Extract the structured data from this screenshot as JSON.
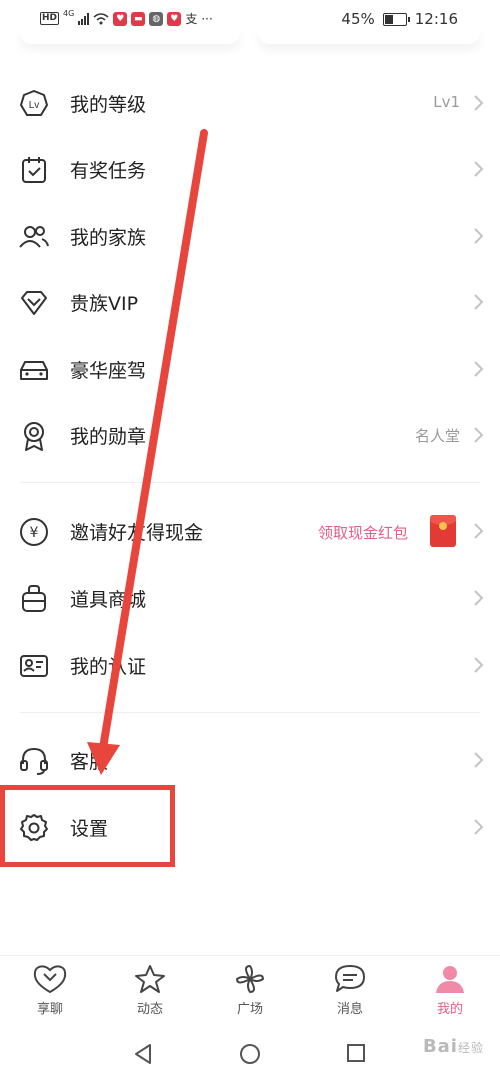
{
  "status_bar": {
    "left_badge": "HD",
    "network_badge": "4G",
    "extra_char": "支",
    "more": "···",
    "battery_percent": "45%",
    "battery_level": 0.45,
    "time": "12:16"
  },
  "menu": {
    "items": [
      {
        "label": "我的等级",
        "icon": "level-icon",
        "right": "Lv1"
      },
      {
        "label": "有奖任务",
        "icon": "task-calendar-icon",
        "right": ""
      },
      {
        "label": "我的家族",
        "icon": "family-people-icon",
        "right": ""
      },
      {
        "label": "贵族VIP",
        "icon": "diamond-icon",
        "right": ""
      },
      {
        "label": "豪华座驾",
        "icon": "car-icon",
        "right": ""
      },
      {
        "label": "我的勋章",
        "icon": "medal-icon",
        "right": "名人堂"
      },
      {
        "label": "邀请好友得现金",
        "icon": "yuan-coin-icon",
        "right": "领取现金红包"
      },
      {
        "label": "道具商城",
        "icon": "shop-bag-icon",
        "right": ""
      },
      {
        "label": "我的认证",
        "icon": "id-card-icon",
        "right": ""
      },
      {
        "label": "客服",
        "icon": "headset-icon",
        "right": ""
      },
      {
        "label": "设置",
        "icon": "gear-icon",
        "right": ""
      }
    ]
  },
  "tabbar": {
    "tabs": [
      {
        "label": "享聊",
        "icon": "chat-hearts-icon",
        "active": false
      },
      {
        "label": "动态",
        "icon": "star-icon",
        "active": false
      },
      {
        "label": "广场",
        "icon": "pinwheel-icon",
        "active": false
      },
      {
        "label": "消息",
        "icon": "message-bubble-icon",
        "active": false
      },
      {
        "label": "我的",
        "icon": "profile-icon",
        "active": true
      }
    ]
  },
  "watermark": {
    "text": "Bai",
    "sub": "经验"
  },
  "colors": {
    "accent": "#e45f86",
    "annotation": "#e8453c",
    "redpacket": "#e23b35"
  }
}
